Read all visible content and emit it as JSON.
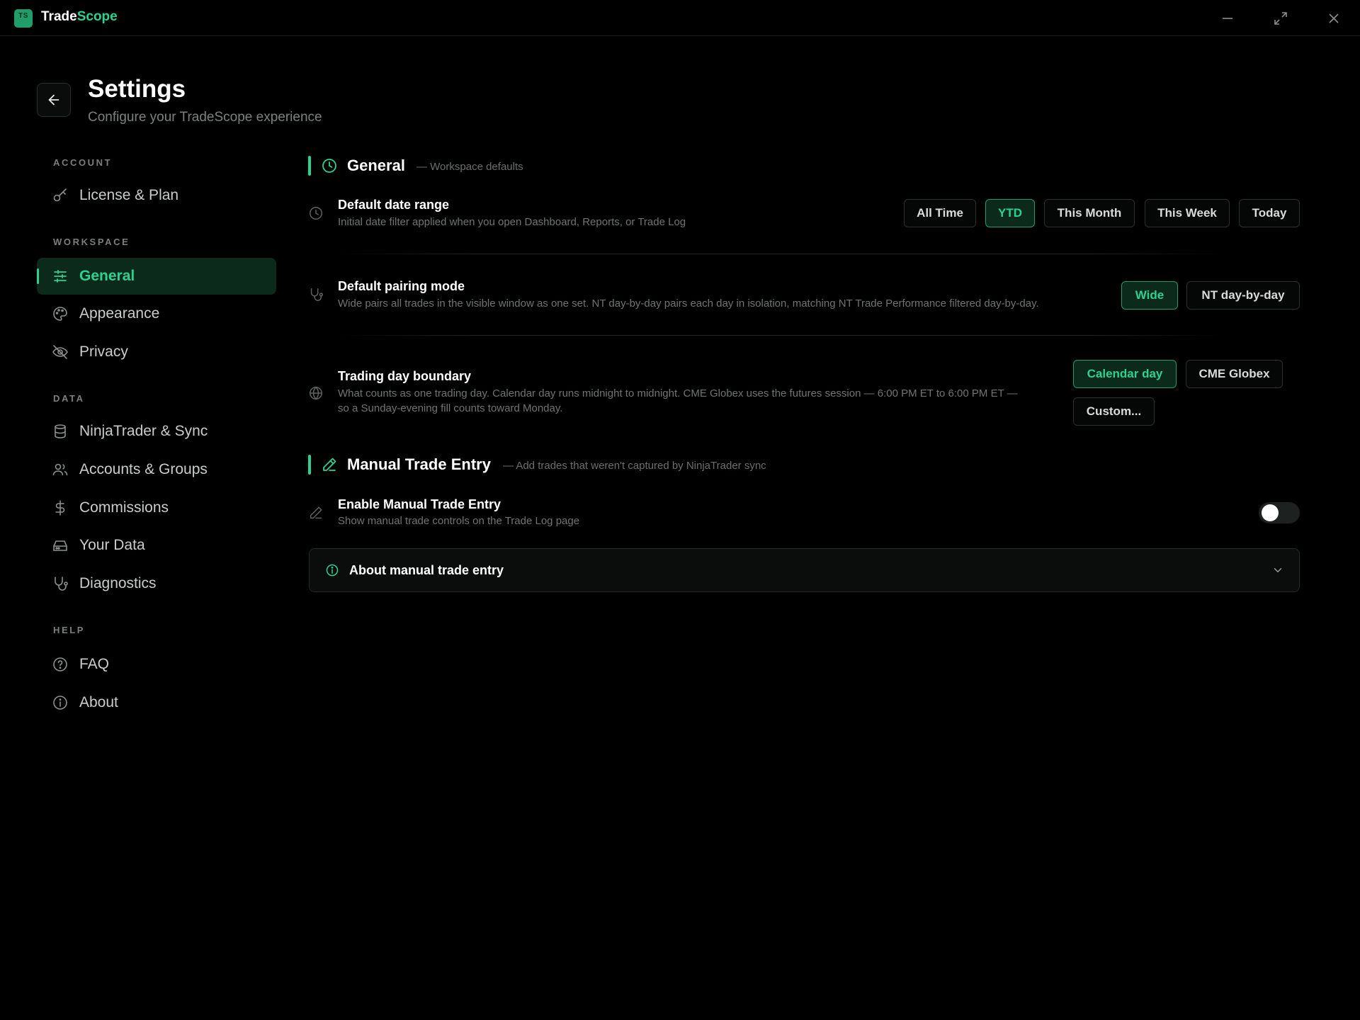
{
  "app": {
    "logo_text": "TS",
    "name_part1": "Trade",
    "name_part2": "Scope",
    "accent_color": "#2bd18f"
  },
  "window_controls": [
    "minimize-icon",
    "maximize-icon",
    "close-icon"
  ],
  "header": {
    "title": "Settings",
    "subtitle": "Configure your TradeScope experience",
    "back_icon": "arrow-left-icon"
  },
  "sidebar": {
    "sections": [
      {
        "label": "ACCOUNT",
        "items": [
          {
            "label": "License & Plan",
            "icon": "key-icon"
          }
        ]
      },
      {
        "label": "WORKSPACE",
        "items": [
          {
            "label": "General",
            "icon": "sliders-icon",
            "active": true
          },
          {
            "label": "Appearance",
            "icon": "palette-icon"
          },
          {
            "label": "Privacy",
            "icon": "eye-off-icon"
          }
        ]
      },
      {
        "label": "DATA",
        "items": [
          {
            "label": "NinjaTrader & Sync",
            "icon": "database-icon"
          },
          {
            "label": "Accounts & Groups",
            "icon": "users-icon"
          },
          {
            "label": "Commissions",
            "icon": "dollar-icon"
          },
          {
            "label": "Your Data",
            "icon": "hard-drive-icon"
          },
          {
            "label": "Diagnostics",
            "icon": "stethoscope-icon"
          }
        ]
      },
      {
        "label": "HELP",
        "items": [
          {
            "label": "FAQ",
            "icon": "help-circle-icon"
          },
          {
            "label": "About",
            "icon": "info-icon"
          }
        ]
      }
    ]
  },
  "general": {
    "title": "General",
    "desc": "— Workspace defaults",
    "icon": "clock-icon",
    "date_range": {
      "label": "Default date range",
      "desc": "Initial date filter applied when you open Dashboard, Reports, or Trade Log",
      "icon": "clock-icon",
      "options": [
        "All Time",
        "YTD",
        "This Month",
        "This Week",
        "Today"
      ],
      "selected": "YTD"
    },
    "pairing": {
      "label": "Default pairing mode",
      "desc": "Wide pairs all trades in the visible window as one set. NT day-by-day pairs each day in isolation, matching NT Trade Performance filtered day-by-day.",
      "icon": "stethoscope-icon",
      "options": [
        "Wide",
        "NT day-by-day"
      ],
      "selected": "Wide"
    },
    "boundary": {
      "label": "Trading day boundary",
      "desc_line1": "What counts as one trading day. Calendar day runs midnight to midnight. CME Globex uses the futures session — 6:00 PM ET to 6:00 PM ET —",
      "desc_line2": "so a Sunday-evening fill counts toward Monday.",
      "icon": "globe-icon",
      "options": [
        "Calendar day",
        "CME Globex",
        "Custom..."
      ],
      "selected": "Calendar day"
    }
  },
  "manual": {
    "title": "Manual Trade Entry",
    "desc": "— Add trades that weren't captured by NinjaTrader sync",
    "icon": "pencil-icon",
    "enable": {
      "label": "Enable Manual Trade Entry",
      "desc": "Show manual trade controls on the Trade Log page",
      "icon": "pencil-icon",
      "enabled": false
    },
    "about": {
      "label": "About manual trade entry",
      "icon": "info-icon",
      "expanded": false
    }
  }
}
